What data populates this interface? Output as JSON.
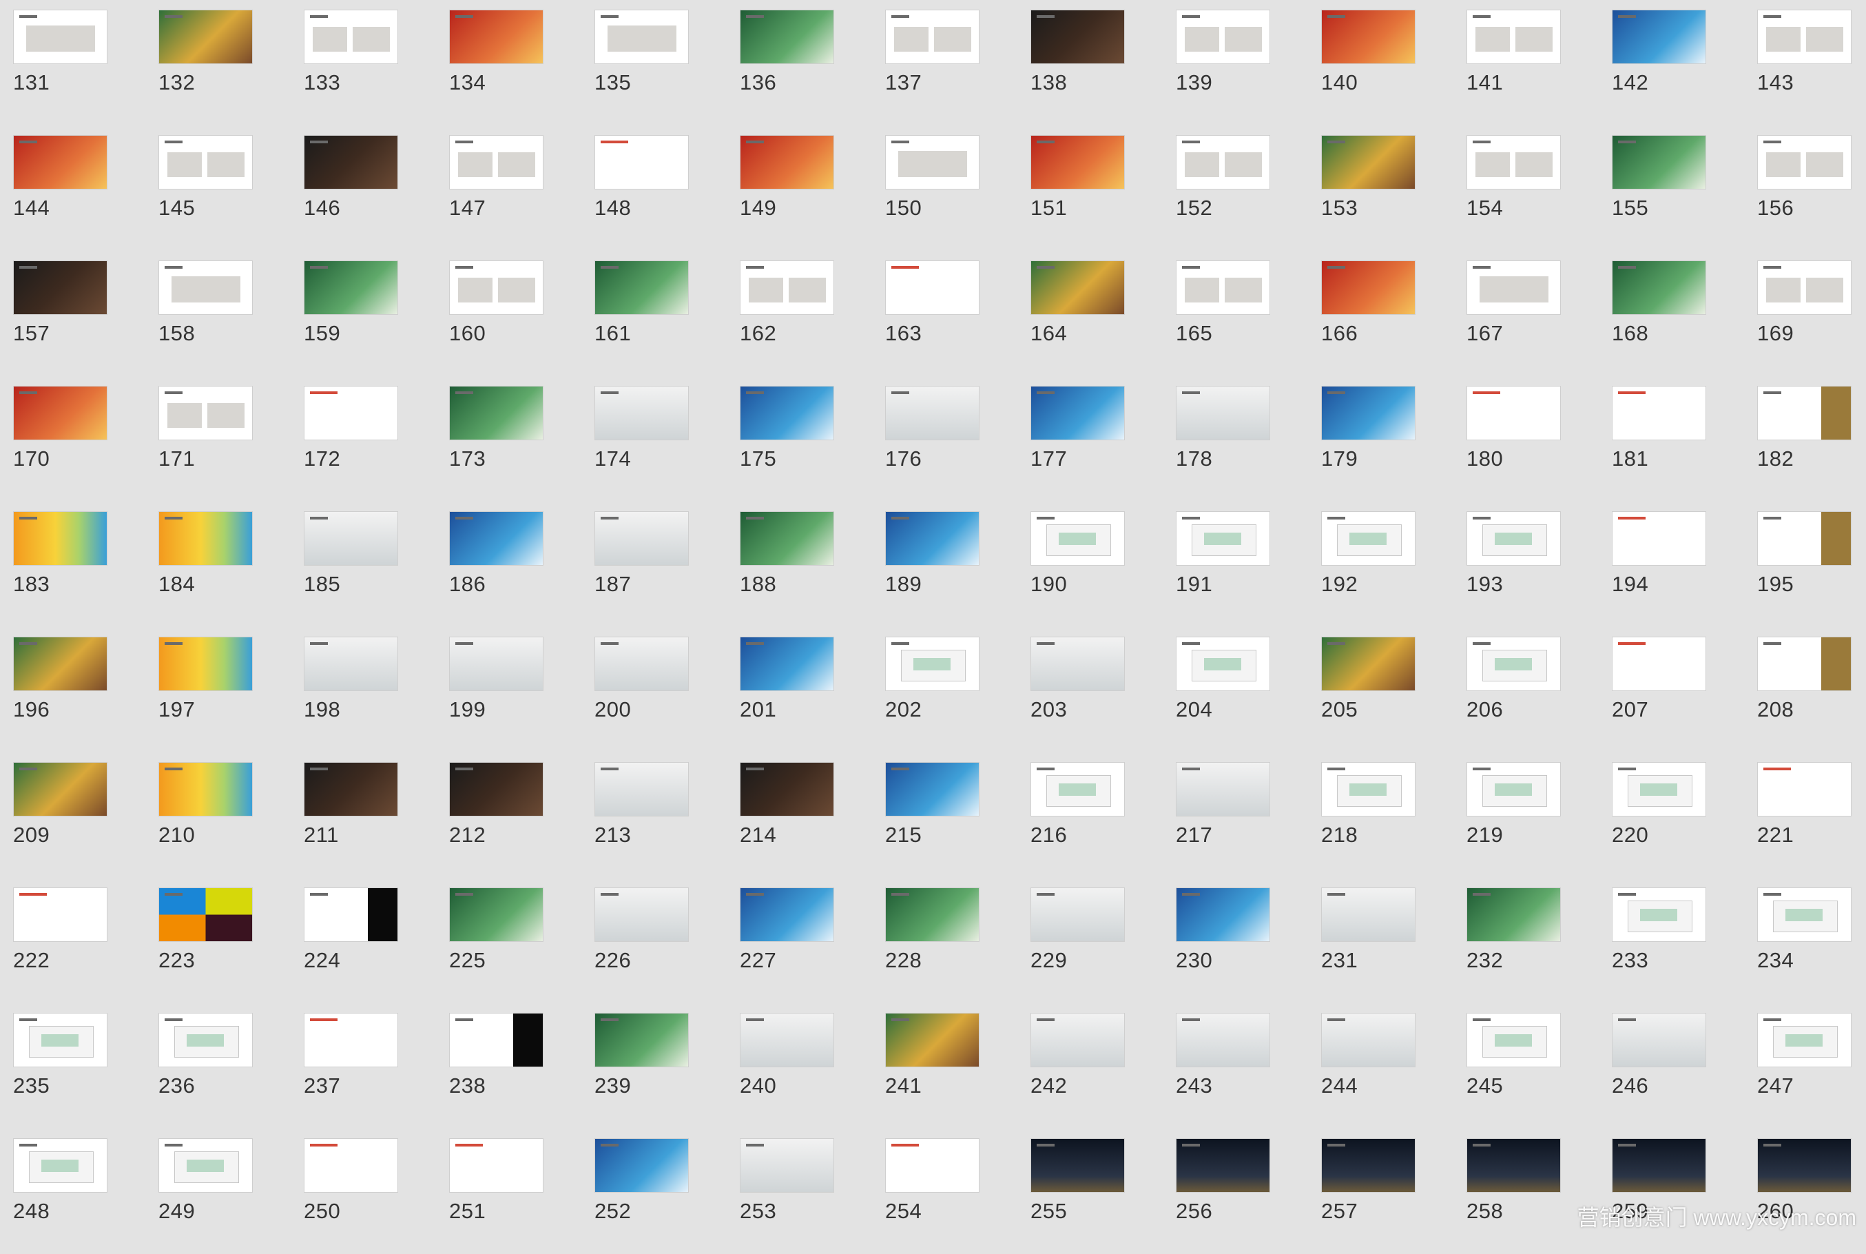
{
  "grid": {
    "columns": 13,
    "rows": 10,
    "start_number": 131
  },
  "slides": [
    {
      "label": "131",
      "style": "plain"
    },
    {
      "label": "132",
      "style": "photo"
    },
    {
      "label": "133",
      "style": "two"
    },
    {
      "label": "134",
      "style": "red"
    },
    {
      "label": "135",
      "style": "plain"
    },
    {
      "label": "136",
      "style": "green"
    },
    {
      "label": "137",
      "style": "two"
    },
    {
      "label": "138",
      "style": "dark"
    },
    {
      "label": "139",
      "style": "two"
    },
    {
      "label": "140",
      "style": "red"
    },
    {
      "label": "141",
      "style": "two"
    },
    {
      "label": "142",
      "style": "blue"
    },
    {
      "label": "143",
      "style": "two"
    },
    {
      "label": "144",
      "style": "red"
    },
    {
      "label": "145",
      "style": "two"
    },
    {
      "label": "146",
      "style": "dark"
    },
    {
      "label": "147",
      "style": "two"
    },
    {
      "label": "148",
      "style": "white"
    },
    {
      "label": "149",
      "style": "red"
    },
    {
      "label": "150",
      "style": "plain"
    },
    {
      "label": "151",
      "style": "red"
    },
    {
      "label": "152",
      "style": "two"
    },
    {
      "label": "153",
      "style": "photo"
    },
    {
      "label": "154",
      "style": "two"
    },
    {
      "label": "155",
      "style": "green"
    },
    {
      "label": "156",
      "style": "two"
    },
    {
      "label": "157",
      "style": "dark"
    },
    {
      "label": "158",
      "style": "plain"
    },
    {
      "label": "159",
      "style": "green"
    },
    {
      "label": "160",
      "style": "two"
    },
    {
      "label": "161",
      "style": "green"
    },
    {
      "label": "162",
      "style": "two"
    },
    {
      "label": "163",
      "style": "white"
    },
    {
      "label": "164",
      "style": "photo"
    },
    {
      "label": "165",
      "style": "two"
    },
    {
      "label": "166",
      "style": "red"
    },
    {
      "label": "167",
      "style": "plain"
    },
    {
      "label": "168",
      "style": "green"
    },
    {
      "label": "169",
      "style": "two"
    },
    {
      "label": "170",
      "style": "red"
    },
    {
      "label": "171",
      "style": "two"
    },
    {
      "label": "172",
      "style": "white"
    },
    {
      "label": "173",
      "style": "green"
    },
    {
      "label": "174",
      "style": "gray"
    },
    {
      "label": "175",
      "style": "blue"
    },
    {
      "label": "176",
      "style": "gray"
    },
    {
      "label": "177",
      "style": "blue"
    },
    {
      "label": "178",
      "style": "gray"
    },
    {
      "label": "179",
      "style": "blue"
    },
    {
      "label": "180",
      "style": "white"
    },
    {
      "label": "181",
      "style": "white"
    },
    {
      "label": "182",
      "style": "gold"
    },
    {
      "label": "183",
      "style": "grad"
    },
    {
      "label": "184",
      "style": "grad"
    },
    {
      "label": "185",
      "style": "gray"
    },
    {
      "label": "186",
      "style": "blue"
    },
    {
      "label": "187",
      "style": "gray"
    },
    {
      "label": "188",
      "style": "green"
    },
    {
      "label": "189",
      "style": "blue"
    },
    {
      "label": "190",
      "style": "mock"
    },
    {
      "label": "191",
      "style": "mock"
    },
    {
      "label": "192",
      "style": "mock"
    },
    {
      "label": "193",
      "style": "mock"
    },
    {
      "label": "194",
      "style": "white"
    },
    {
      "label": "195",
      "style": "gold"
    },
    {
      "label": "196",
      "style": "photo"
    },
    {
      "label": "197",
      "style": "grad"
    },
    {
      "label": "198",
      "style": "gray"
    },
    {
      "label": "199",
      "style": "gray"
    },
    {
      "label": "200",
      "style": "gray"
    },
    {
      "label": "201",
      "style": "blue"
    },
    {
      "label": "202",
      "style": "mock"
    },
    {
      "label": "203",
      "style": "gray"
    },
    {
      "label": "204",
      "style": "mock"
    },
    {
      "label": "205",
      "style": "photo"
    },
    {
      "label": "206",
      "style": "mock"
    },
    {
      "label": "207",
      "style": "white"
    },
    {
      "label": "208",
      "style": "gold"
    },
    {
      "label": "209",
      "style": "photo"
    },
    {
      "label": "210",
      "style": "grad"
    },
    {
      "label": "211",
      "style": "dark"
    },
    {
      "label": "212",
      "style": "dark"
    },
    {
      "label": "213",
      "style": "gray"
    },
    {
      "label": "214",
      "style": "dark"
    },
    {
      "label": "215",
      "style": "blue"
    },
    {
      "label": "216",
      "style": "mock"
    },
    {
      "label": "217",
      "style": "gray"
    },
    {
      "label": "218",
      "style": "mock"
    },
    {
      "label": "219",
      "style": "mock"
    },
    {
      "label": "220",
      "style": "mock"
    },
    {
      "label": "221",
      "style": "white"
    },
    {
      "label": "222",
      "style": "white"
    },
    {
      "label": "223",
      "style": "quad"
    },
    {
      "label": "224",
      "style": "black"
    },
    {
      "label": "225",
      "style": "green"
    },
    {
      "label": "226",
      "style": "gray"
    },
    {
      "label": "227",
      "style": "blue"
    },
    {
      "label": "228",
      "style": "green"
    },
    {
      "label": "229",
      "style": "gray"
    },
    {
      "label": "230",
      "style": "blue"
    },
    {
      "label": "231",
      "style": "gray"
    },
    {
      "label": "232",
      "style": "green"
    },
    {
      "label": "233",
      "style": "mock"
    },
    {
      "label": "234",
      "style": "mock"
    },
    {
      "label": "235",
      "style": "mock"
    },
    {
      "label": "236",
      "style": "mock"
    },
    {
      "label": "237",
      "style": "white"
    },
    {
      "label": "238",
      "style": "black"
    },
    {
      "label": "239",
      "style": "green"
    },
    {
      "label": "240",
      "style": "gray"
    },
    {
      "label": "241",
      "style": "photo"
    },
    {
      "label": "242",
      "style": "gray"
    },
    {
      "label": "243",
      "style": "gray"
    },
    {
      "label": "244",
      "style": "gray"
    },
    {
      "label": "245",
      "style": "mock"
    },
    {
      "label": "246",
      "style": "gray"
    },
    {
      "label": "247",
      "style": "mock"
    },
    {
      "label": "248",
      "style": "mock"
    },
    {
      "label": "249",
      "style": "mock"
    },
    {
      "label": "250",
      "style": "white"
    },
    {
      "label": "251",
      "style": "white"
    },
    {
      "label": "252",
      "style": "blue"
    },
    {
      "label": "253",
      "style": "gray"
    },
    {
      "label": "254",
      "style": "white"
    },
    {
      "label": "255",
      "style": "night"
    },
    {
      "label": "256",
      "style": "night"
    },
    {
      "label": "257",
      "style": "night"
    },
    {
      "label": "258",
      "style": "night"
    },
    {
      "label": "259",
      "style": "night"
    },
    {
      "label": "260",
      "style": "night"
    }
  ],
  "watermark": "营销创意门 www.yxcym.com"
}
